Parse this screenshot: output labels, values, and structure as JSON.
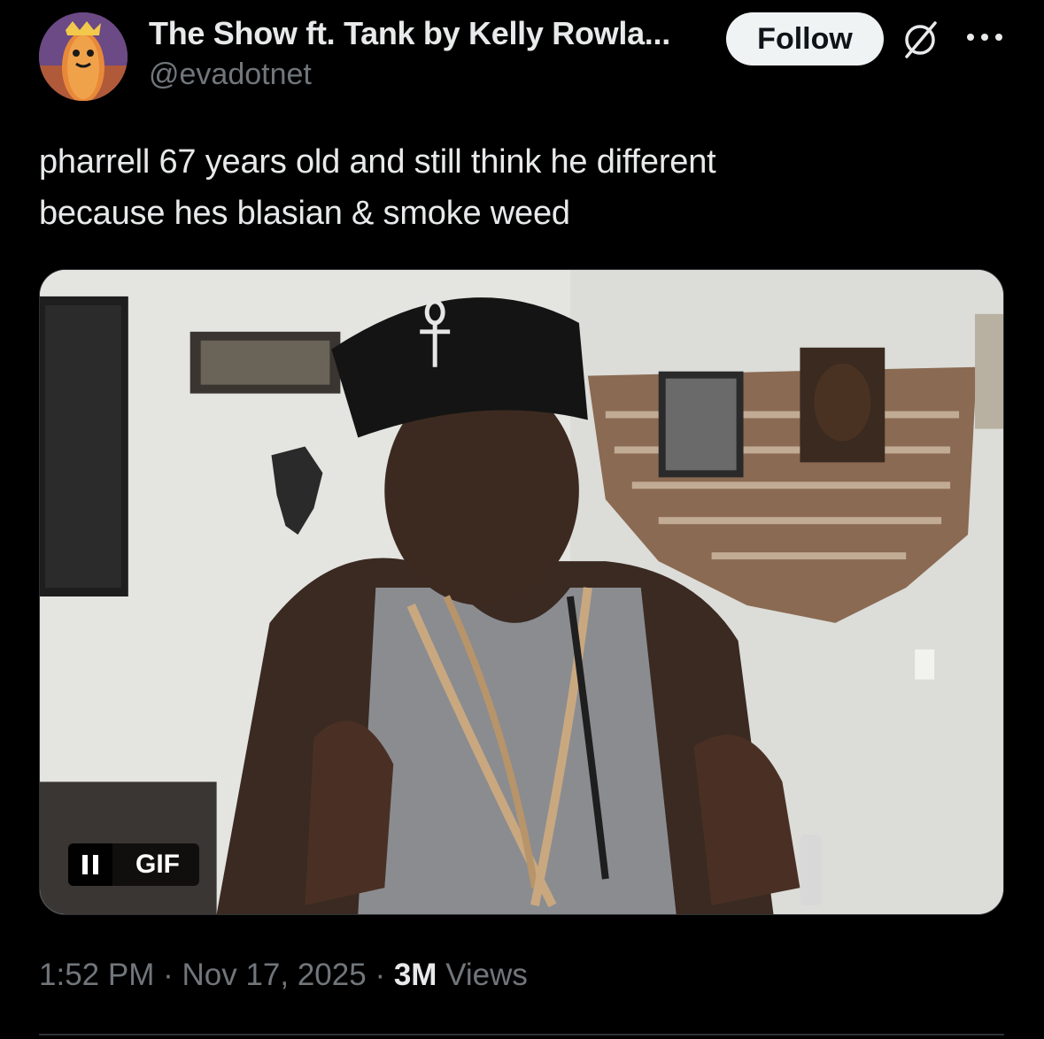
{
  "author": {
    "display_name": "The Show ft. Tank by Kelly Rowla...",
    "handle": "@evadotnet",
    "avatar_icon": "hotdog-character-avatar"
  },
  "actions": {
    "follow_label": "Follow",
    "grok_icon": "grok-icon",
    "more_icon": "more-icon"
  },
  "tweet": {
    "text": "pharrell 67 years old and still think he different\nbecause hes blasian & smoke weed"
  },
  "media": {
    "type": "gif",
    "badge_label": "GIF",
    "pause_icon": "pause-icon"
  },
  "meta": {
    "time": "1:52 PM",
    "separator": "·",
    "date": "Nov 17, 2025",
    "views_count": "3M",
    "views_label": "Views"
  },
  "colors": {
    "background": "#000000",
    "primary_text": "#e7e9ea",
    "secondary_text": "#71767b",
    "follow_bg": "#eff3f4",
    "divider": "#2f3336"
  }
}
